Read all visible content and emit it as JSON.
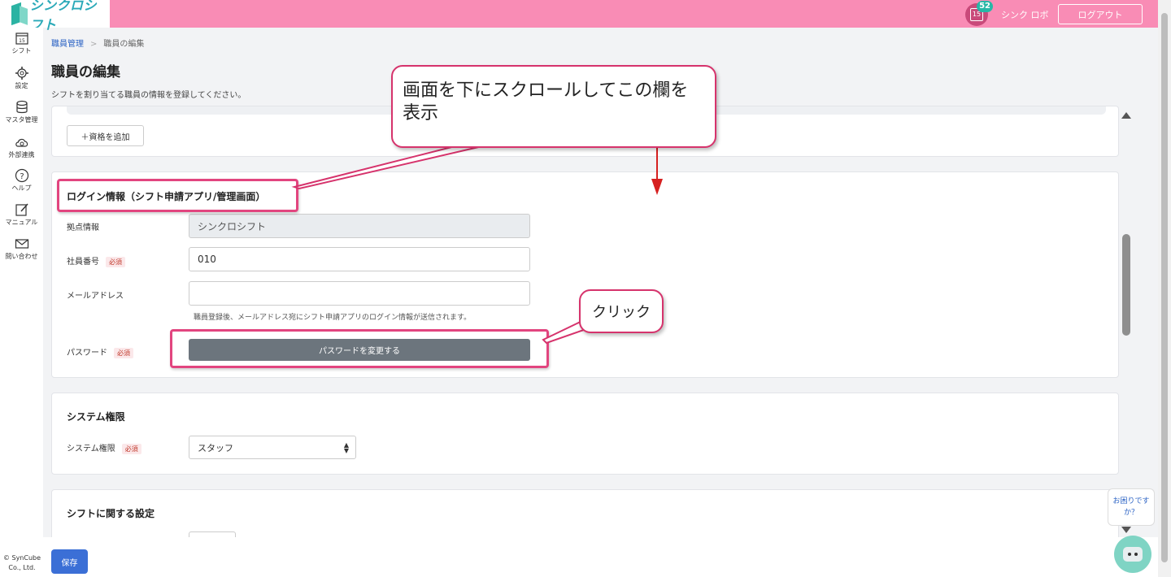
{
  "header": {
    "logo_text": "シンクロシフト",
    "badge_count": "52",
    "calendar_day": "15",
    "user_name": "シンク ロボ",
    "logout_label": "ログアウト",
    "colors": {
      "bar": "#f98cb5",
      "logo": "#2aa9b8"
    }
  },
  "sidebar": {
    "items": [
      {
        "icon": "calendar-icon",
        "label": "シフト",
        "day": "15"
      },
      {
        "icon": "gear-icon",
        "label": "設定"
      },
      {
        "icon": "database-icon",
        "label": "マスタ管理"
      },
      {
        "icon": "cloud-sync-icon",
        "label": "外部連携"
      },
      {
        "icon": "help-circle-icon",
        "label": "ヘルプ"
      },
      {
        "icon": "edit-note-icon",
        "label": "マニュアル"
      },
      {
        "icon": "mail-icon",
        "label": "問い合わせ"
      }
    ],
    "copyright": "© SynCube Co., Ltd."
  },
  "breadcrumb": {
    "parent": "職員管理",
    "separator": ">",
    "current": "職員の編集"
  },
  "page": {
    "title": "職員の編集",
    "description": "シフトを割り当てる職員の情報を登録してください。"
  },
  "qualification": {
    "add_label": "＋資格を追加"
  },
  "login_section": {
    "title": "ログイン情報（シフト申請アプリ/管理画面）",
    "site_label": "拠点情報",
    "site_value": "シンクロシフト",
    "employee_no_label": "社員番号",
    "employee_no_value": "010",
    "email_label": "メールアドレス",
    "email_value": "",
    "email_help": "職員登録後、メールアドレス宛にシフト申請アプリのログイン情報が送信されます。",
    "password_label": "パスワード",
    "password_button": "パスワードを変更する",
    "required": "必須"
  },
  "system_section": {
    "title": "システム権限",
    "role_label": "システム権限",
    "role_value": "スタッフ",
    "required": "必須"
  },
  "shift_section": {
    "title": "シフトに関する設定"
  },
  "footer": {
    "save_label": "保存"
  },
  "help_widget": {
    "text": "お困りですか？"
  },
  "annotations": {
    "callout_scroll": "画面を下にスクロールしてこの欄を表示",
    "callout_click": "クリック",
    "highlight_color": "#e2457f",
    "arrow_color": "#d62020"
  }
}
